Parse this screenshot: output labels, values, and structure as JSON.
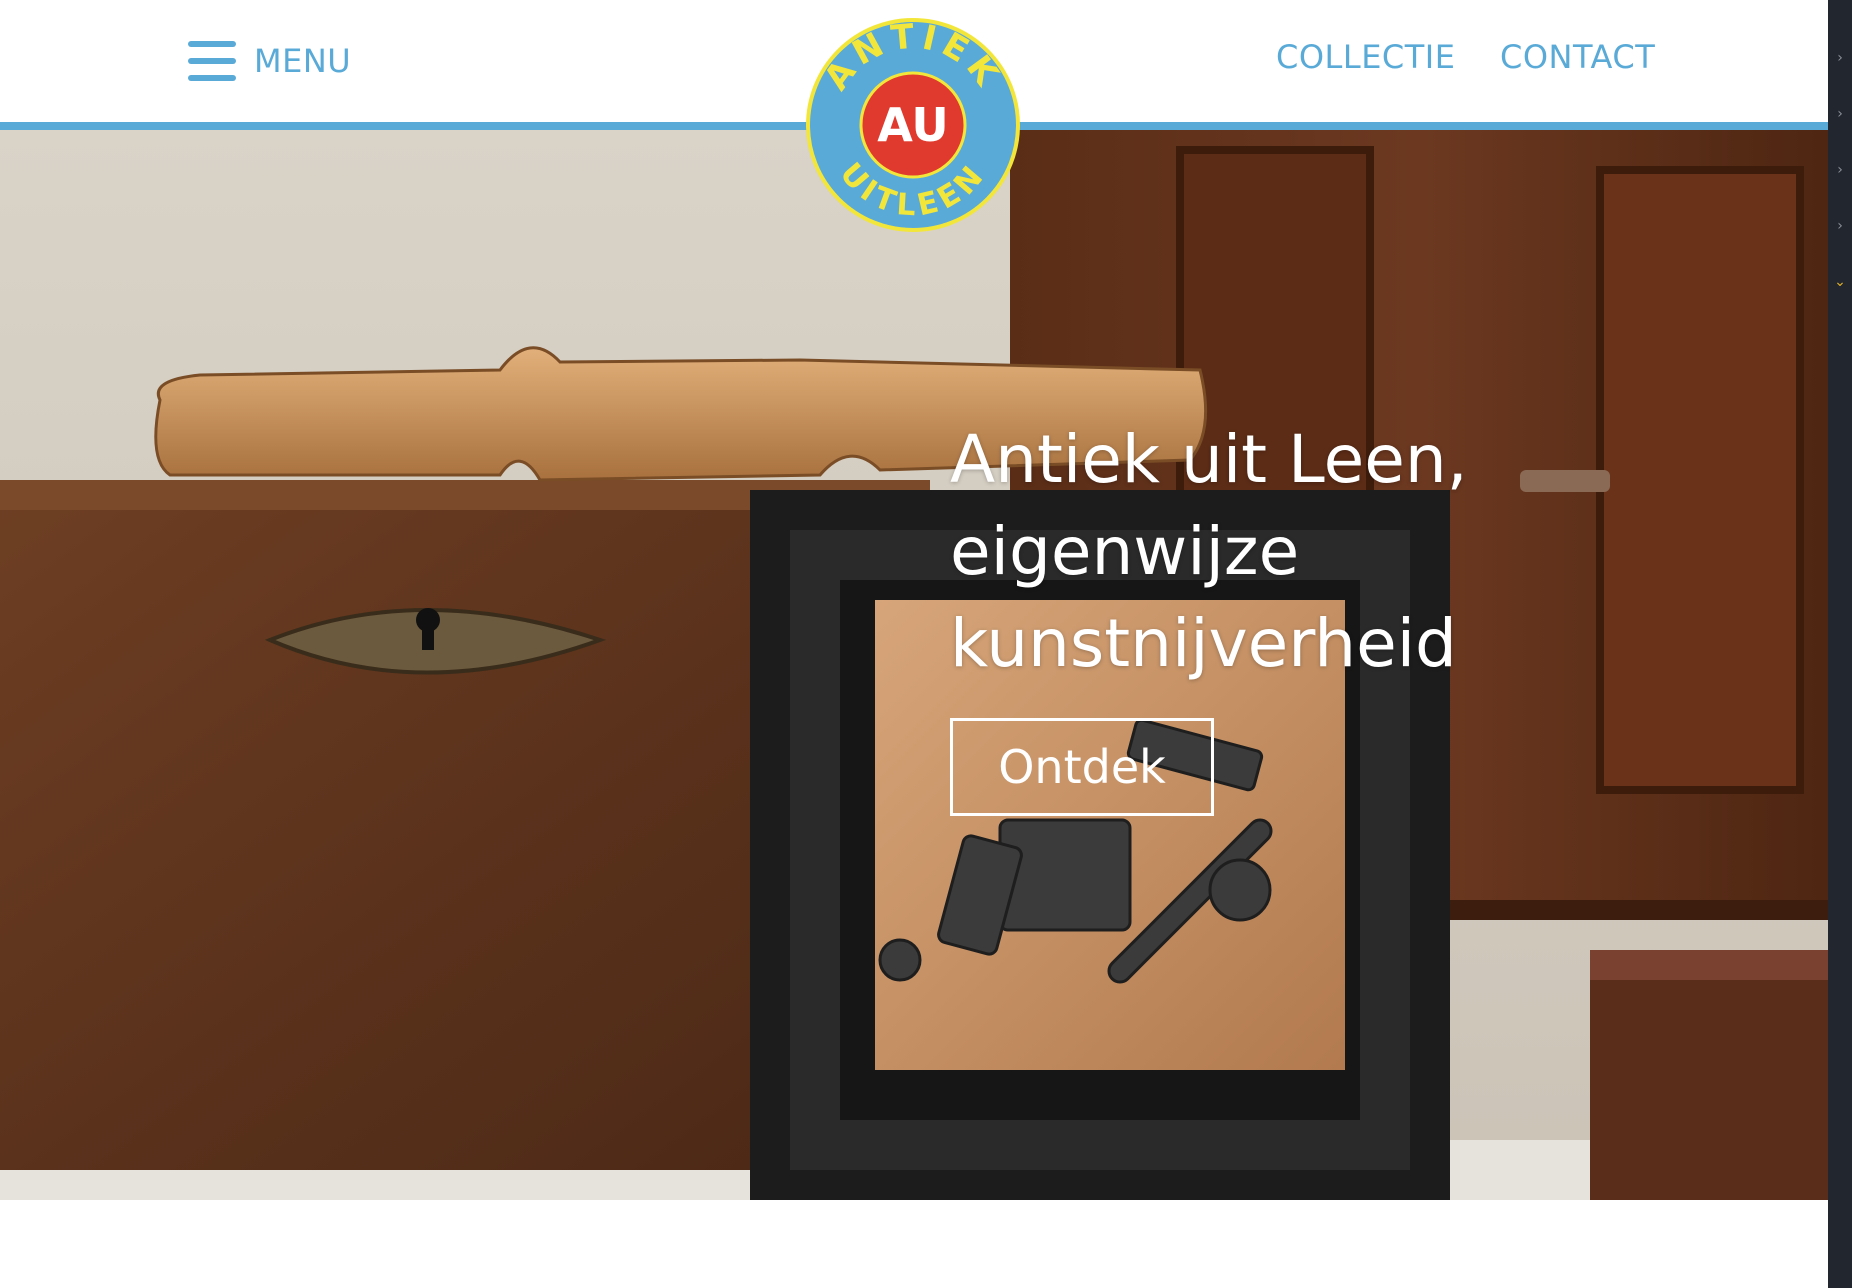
{
  "header": {
    "menu_label": "MENU",
    "nav": [
      {
        "label": "COLLECTIE"
      },
      {
        "label": "CONTACT"
      }
    ]
  },
  "logo": {
    "monogram": "AU",
    "ring_text_top": "ANTIEK",
    "ring_text_bottom": "UITLEEN"
  },
  "hero": {
    "title_lines": [
      "Antiek uit Leen,",
      "eigenwijze",
      "kunstnijverheid"
    ],
    "cta_label": "Ontdek"
  },
  "colors": {
    "accent": "#5aaad8",
    "logo_red": "#e03a2e",
    "logo_yellow": "#f3e63a"
  },
  "side_strip": {
    "icons": [
      "chevron-right-icon",
      "chevron-right-icon",
      "chevron-right-icon",
      "chevron-right-icon",
      "chevron-down-icon"
    ]
  }
}
